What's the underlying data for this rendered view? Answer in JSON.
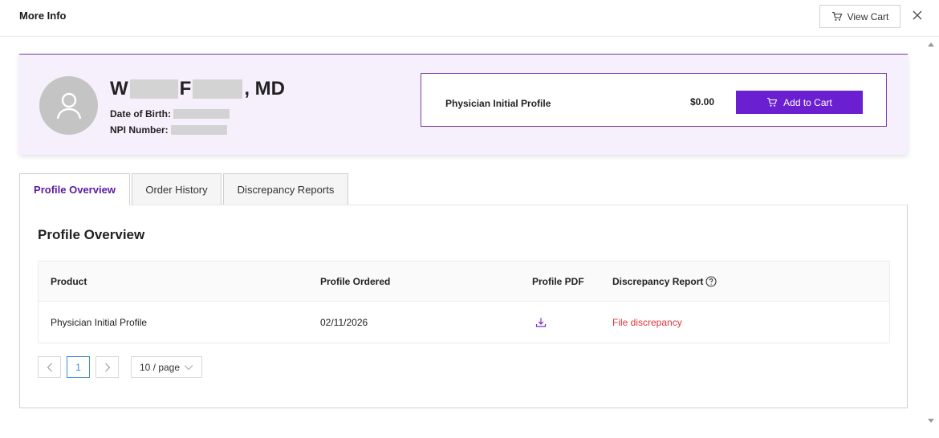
{
  "modal": {
    "title": "More Info",
    "view_cart_label": "View Cart",
    "icons": {
      "cart": "cart-icon",
      "close": "close-icon"
    }
  },
  "profile": {
    "name_prefix": "W",
    "name_middle": "F",
    "name_suffix": ", MD",
    "dob_label": "Date of Birth:",
    "npi_label": "NPI Number:",
    "avatar_icon": "user-icon"
  },
  "product_box": {
    "name": "Physician Initial Profile",
    "price": "$0.00",
    "add_to_cart_label": "Add to Cart"
  },
  "tabs": [
    {
      "label": "Profile Overview",
      "active": true
    },
    {
      "label": "Order History",
      "active": false
    },
    {
      "label": "Discrepancy Reports",
      "active": false
    }
  ],
  "overview": {
    "title": "Profile Overview",
    "columns": [
      "Product",
      "Profile Ordered",
      "Profile PDF",
      "Discrepancy Report"
    ],
    "rows": [
      {
        "product": "Physician Initial Profile",
        "ordered": "02/11/2026",
        "pdf_icon": "download-icon",
        "discrepancy_link": "File discrepancy"
      }
    ]
  },
  "pagination": {
    "current_page": "1",
    "page_size": "10 / page"
  },
  "colors": {
    "accent": "#6a1fd1",
    "header_bg": "#f6f0fd",
    "danger": "#e0323a",
    "active_tab_text": "#5b1aa6"
  }
}
